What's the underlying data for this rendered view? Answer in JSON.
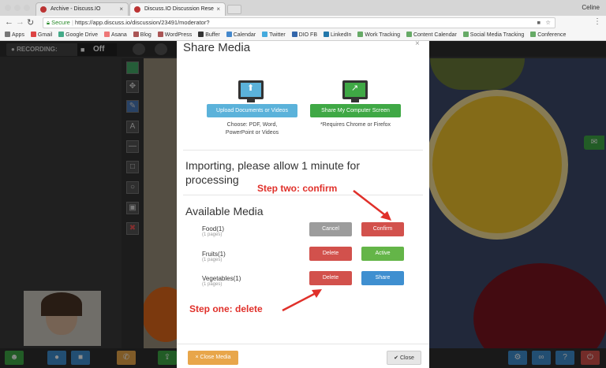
{
  "browser": {
    "user_name": "Celine",
    "tabs": [
      {
        "title": "Archive - Discuss.IO",
        "active": false
      },
      {
        "title": "Discuss.IO Discussion Rese",
        "active": true
      }
    ],
    "address": {
      "secure_label": "Secure",
      "url": "https://app.discuss.io/discussion/23491/moderator?"
    },
    "bookmarks": [
      "Apps",
      "Gmail",
      "Google Drive",
      "Asana",
      "Blog",
      "WordPress",
      "Buffer",
      "Calendar",
      "Twitter",
      "DIO FB",
      "LinkedIn",
      "Work Tracking",
      "Content Calendar",
      "Social Media Tracking",
      "Conference"
    ]
  },
  "app": {
    "recording_label": "RECORDING:",
    "recording_state": "Off"
  },
  "modal": {
    "title": "Share Media",
    "upload_button": "Upload Documents or Videos",
    "upload_help_1": "Choose: PDF, Word,",
    "upload_help_2": "PowerPoint or Videos",
    "screen_button": "Share My Computer Screen",
    "screen_help": "*Requires Chrome or Firefox",
    "importing_1": "Importing, please allow 1 minute for",
    "importing_2": "processing",
    "available_heading": "Available Media",
    "items": [
      {
        "name": "Food(1)",
        "pages": "(1 pages)",
        "btn1": "Cancel",
        "btn2": "Confirm"
      },
      {
        "name": "Fruits(1)",
        "pages": "(1 pages)",
        "btn1": "Delete",
        "btn2": "Active"
      },
      {
        "name": "Vegetables(1)",
        "pages": "(1 pages)",
        "btn1": "Delete",
        "btn2": "Share"
      }
    ],
    "close_media_button": "× Close Media",
    "close_button": "✔ Close"
  },
  "annotations": {
    "step_two": "Step two: confirm",
    "step_one": "Step one: delete"
  },
  "colors": {
    "upload_blue": "#5bb2da",
    "screen_green": "#3fa845",
    "cancel_gray": "#9c9c9c",
    "danger_red": "#d2514c",
    "active_green": "#64b548",
    "share_blue": "#3f8fd0",
    "close_media_orange": "#e8a64a",
    "annotation_red": "#e0302a"
  }
}
